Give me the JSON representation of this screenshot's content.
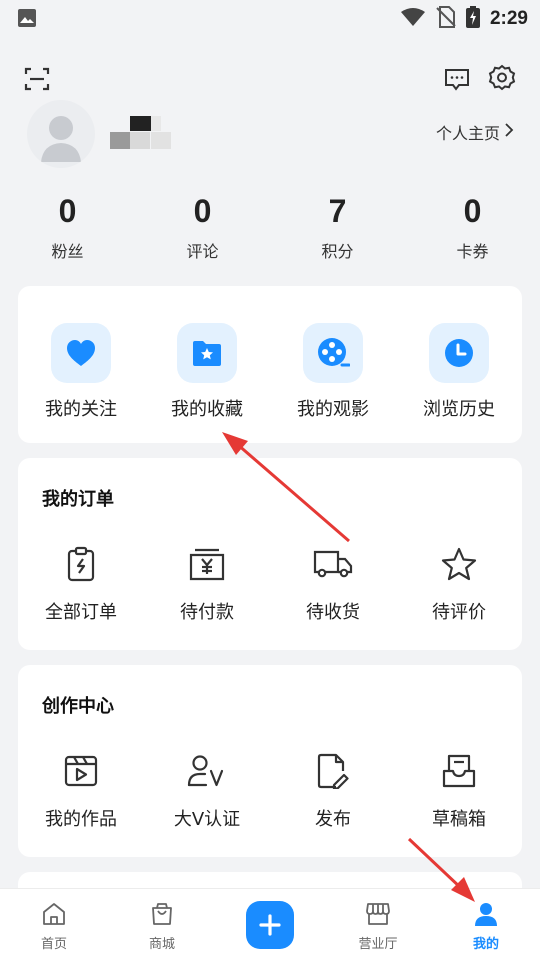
{
  "status_bar": {
    "time": "2:29"
  },
  "profile": {
    "homepage_link": "个人主页"
  },
  "stats": [
    {
      "value": "0",
      "label": "粉丝"
    },
    {
      "value": "0",
      "label": "评论"
    },
    {
      "value": "7",
      "label": "积分"
    },
    {
      "value": "0",
      "label": "卡券"
    }
  ],
  "quick_actions": [
    {
      "label": "我的关注",
      "icon": "heart-icon"
    },
    {
      "label": "我的收藏",
      "icon": "star-folder-icon"
    },
    {
      "label": "我的观影",
      "icon": "film-reel-icon"
    },
    {
      "label": "浏览历史",
      "icon": "clock-icon"
    }
  ],
  "orders": {
    "title": "我的订单",
    "items": [
      {
        "label": "全部订单",
        "icon": "clipboard-icon"
      },
      {
        "label": "待付款",
        "icon": "yuan-wallet-icon"
      },
      {
        "label": "待收货",
        "icon": "truck-icon"
      },
      {
        "label": "待评价",
        "icon": "star-outline-icon"
      }
    ]
  },
  "creation": {
    "title": "创作中心",
    "items": [
      {
        "label": "我的作品",
        "icon": "video-clapper-icon"
      },
      {
        "label": "大V认证",
        "icon": "user-v-icon"
      },
      {
        "label": "发布",
        "icon": "document-edit-icon"
      },
      {
        "label": "草稿箱",
        "icon": "draft-tray-icon"
      }
    ]
  },
  "tab_bar": {
    "items": [
      {
        "label": "首页",
        "icon": "home-icon"
      },
      {
        "label": "商城",
        "icon": "shopping-bag-icon"
      },
      {
        "label": "",
        "icon": "plus-icon"
      },
      {
        "label": "营业厅",
        "icon": "store-icon"
      },
      {
        "label": "我的",
        "icon": "person-icon",
        "active": true
      }
    ]
  },
  "colors": {
    "accent": "#1a8cff",
    "background": "#f2f3f5",
    "annotation_arrow": "#e53935"
  }
}
